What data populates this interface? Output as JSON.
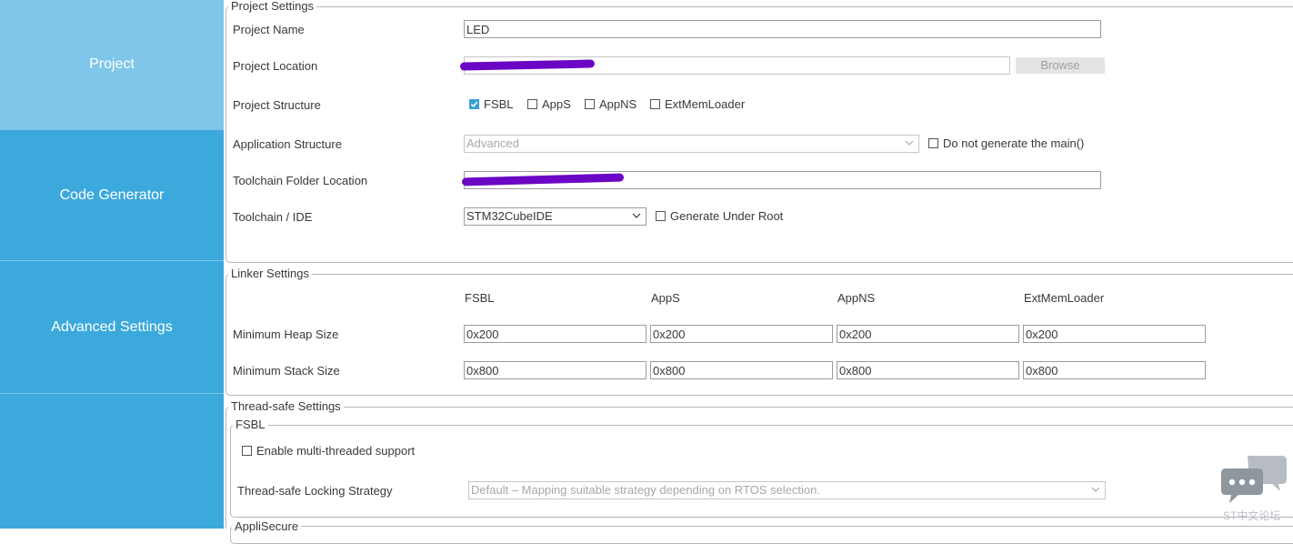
{
  "sidebar": {
    "items": [
      {
        "label": "Project",
        "active": true
      },
      {
        "label": "Code Generator",
        "active": false
      },
      {
        "label": "Advanced Settings",
        "active": false
      },
      {
        "label": "",
        "active": false
      }
    ]
  },
  "project_settings": {
    "legend": "Project Settings",
    "name_label": "Project Name",
    "name_value": "LED",
    "location_label": "Project Location",
    "location_value": "",
    "browse_label": "Browse",
    "structure_label": "Project Structure",
    "structure_options": [
      {
        "label": "FSBL",
        "checked": true
      },
      {
        "label": "AppS",
        "checked": false
      },
      {
        "label": "AppNS",
        "checked": false
      },
      {
        "label": "ExtMemLoader",
        "checked": false
      }
    ],
    "app_structure_label": "Application Structure",
    "app_structure_value": "Advanced",
    "no_main_label": "Do not generate the main()",
    "toolchain_folder_label": "Toolchain Folder Location",
    "toolchain_folder_value": "",
    "toolchain_ide_label": "Toolchain / IDE",
    "toolchain_ide_value": "STM32CubeIDE",
    "gen_under_root_label": "Generate Under Root"
  },
  "linker_settings": {
    "legend": "Linker Settings",
    "columns": [
      "FSBL",
      "AppS",
      "AppNS",
      "ExtMemLoader"
    ],
    "heap_label": "Minimum Heap Size",
    "heap_values": [
      "0x200",
      "0x200",
      "0x200",
      "0x200"
    ],
    "stack_label": "Minimum Stack Size",
    "stack_values": [
      "0x800",
      "0x800",
      "0x800",
      "0x800"
    ]
  },
  "thread_safe": {
    "legend": "Thread-safe Settings",
    "fsbl_legend": "FSBL",
    "multithread_label": "Enable multi-threaded support",
    "strategy_label": "Thread-safe Locking Strategy",
    "strategy_value": "Default – Mapping suitable strategy depending on RTOS selection."
  },
  "appli_secure": {
    "legend": "AppliSecure"
  },
  "watermark": {
    "text": "ST中文论坛"
  },
  "colors": {
    "sidebar": "#3ca9dc",
    "sidebar_active": "#7fc6ea",
    "checkbox": "#3c9fd8",
    "redaction": "#6a06c4"
  }
}
